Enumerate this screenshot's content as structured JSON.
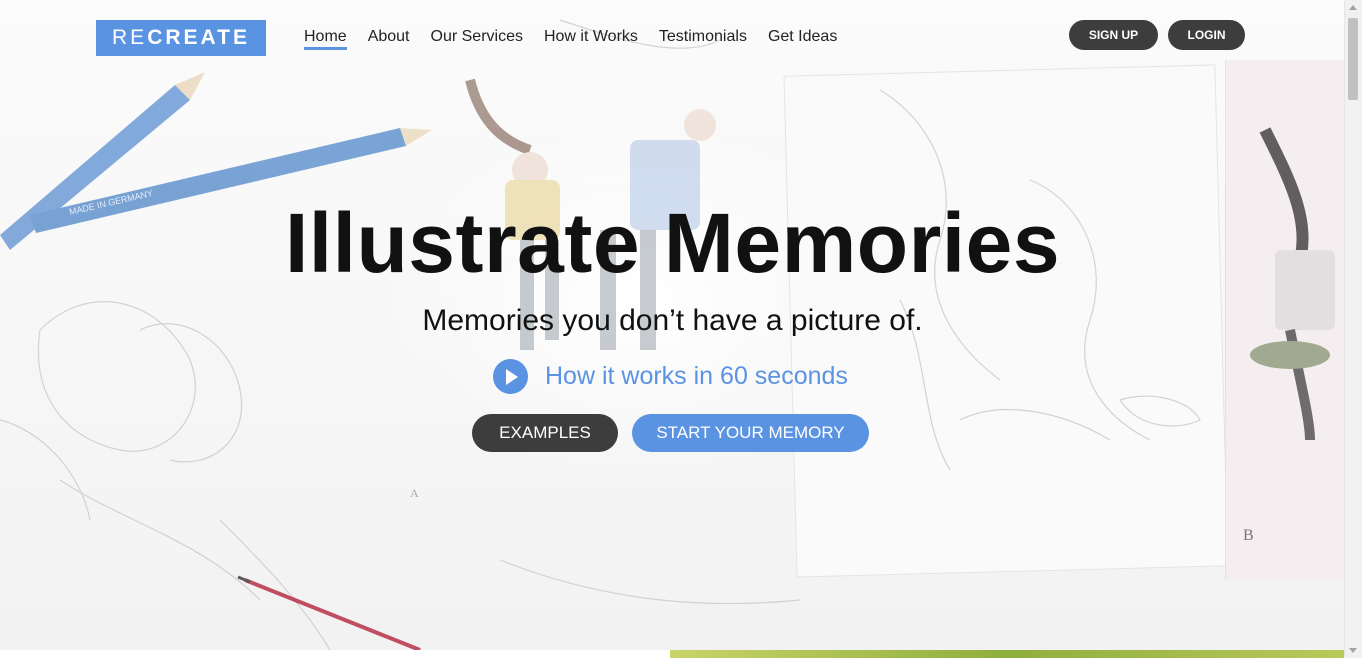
{
  "logo": {
    "light": "RE",
    "bold": "CREATE"
  },
  "nav": {
    "items": [
      {
        "label": "Home",
        "active": true
      },
      {
        "label": "About"
      },
      {
        "label": "Our Services"
      },
      {
        "label": "How it Works"
      },
      {
        "label": "Testimonials"
      },
      {
        "label": "Get Ideas"
      }
    ]
  },
  "auth": {
    "signup": "SIGN UP",
    "login": "LOGIN"
  },
  "hero": {
    "title": "Illustrate Memories",
    "subtitle": "Memories you don’t have a picture of.",
    "video_link": "How it works in 60 seconds",
    "play_icon": "play-icon",
    "buttons": {
      "examples": "EXAMPLES",
      "start": "START YOUR MEMORY"
    }
  },
  "colors": {
    "accent": "#5b93e3",
    "dark_button": "#3d3d3d",
    "text": "#111111"
  }
}
